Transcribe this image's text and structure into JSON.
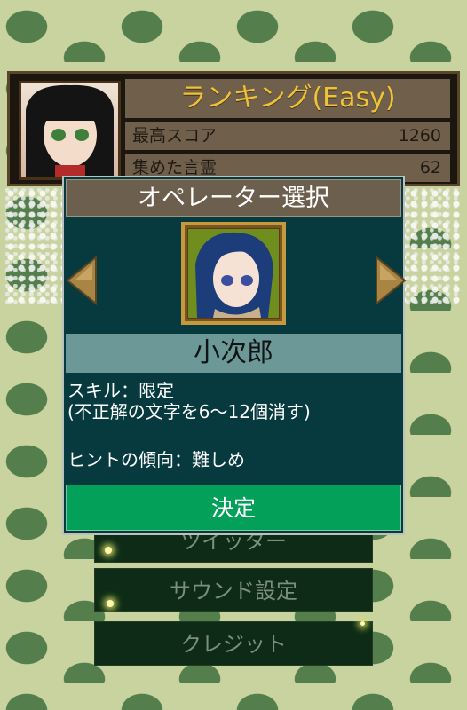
{
  "ranking": {
    "title": "ランキング(Easy)",
    "high_score_label": "最高スコア",
    "high_score_value": "1260",
    "collected_label": "集めた言霊",
    "collected_value": "62"
  },
  "menu": {
    "items": [
      "ツイッター",
      "サウンド設定",
      "クレジット"
    ]
  },
  "dialog": {
    "title": "オペレーター選択",
    "operator_name": "小次郎",
    "skill_line1": "スキル：限定",
    "skill_line2": "(不正解の文字を6〜12個消す)",
    "hint_line": "ヒントの傾向：難しめ",
    "confirm_label": "決定"
  },
  "colors": {
    "dialog_bg": "#073a3f",
    "title_bar": "#6d5f4e",
    "name_bar": "#6d9898",
    "confirm": "#03a05a",
    "ranking_title_text": "#f0c235"
  }
}
